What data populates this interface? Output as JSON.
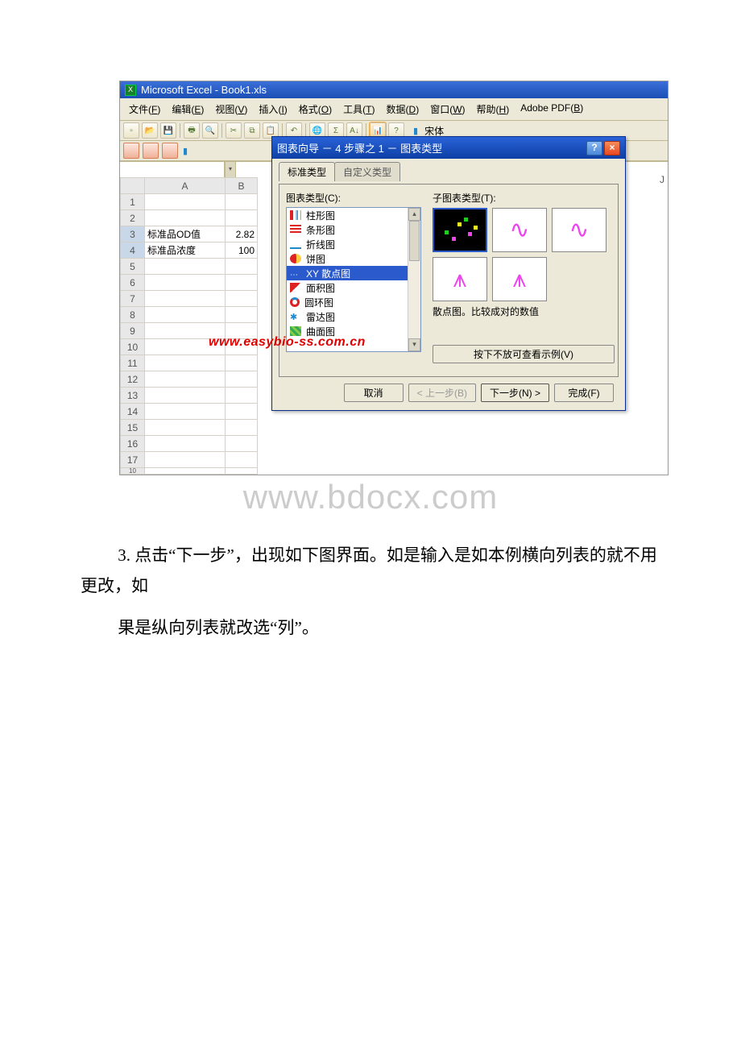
{
  "app_title": "Microsoft Excel - Book1.xls",
  "menu": [
    {
      "label": "文件",
      "hotkey": "F"
    },
    {
      "label": "编辑",
      "hotkey": "E"
    },
    {
      "label": "视图",
      "hotkey": "V"
    },
    {
      "label": "插入",
      "hotkey": "I"
    },
    {
      "label": "格式",
      "hotkey": "O"
    },
    {
      "label": "工具",
      "hotkey": "T"
    },
    {
      "label": "数据",
      "hotkey": "D"
    },
    {
      "label": "窗口",
      "hotkey": "W"
    },
    {
      "label": "帮助",
      "hotkey": "H"
    },
    {
      "label": "Adobe PDF",
      "hotkey": "B"
    }
  ],
  "font_name": "宋体",
  "columns": [
    "A",
    "B"
  ],
  "right_col_marker": "J",
  "rows": [
    "1",
    "2",
    "3",
    "4",
    "5",
    "6",
    "7",
    "8",
    "9",
    "10",
    "11",
    "12",
    "13",
    "14",
    "15",
    "16",
    "17"
  ],
  "last_row_fragment": "10",
  "cells": {
    "A3": "标准品OD值",
    "B3": "2.82",
    "A4": "标准品浓度",
    "B4": "100"
  },
  "dialog": {
    "title": "图表向导 － 4 步骤之 1 － 图表类型",
    "tabs": {
      "standard": "标准类型",
      "custom": "自定义类型"
    },
    "type_label": "图表类型(C):",
    "subtype_label": "子图表类型(T):",
    "types": [
      "柱形图",
      "条形图",
      "折线图",
      "饼图",
      "XY 散点图",
      "面积图",
      "圆环图",
      "雷达图",
      "曲面图"
    ],
    "selected_type_index": 4,
    "description": "散点图。比较成对的数值",
    "preview_btn": "按下不放可查看示例(V)",
    "buttons": {
      "cancel": "取消",
      "back": "< 上一步(B)",
      "next": "下一步(N) >",
      "finish": "完成(F)"
    }
  },
  "watermarks": {
    "red": "www.easybio-ss.com.cn",
    "gray": "www.bdocx.com"
  },
  "body_text": {
    "p1": "3. 点击“下一步”，出现如下图界面。如是输入是如本例横向列表的就不用更改，如",
    "p2": "果是纵向列表就改选“列”。"
  }
}
